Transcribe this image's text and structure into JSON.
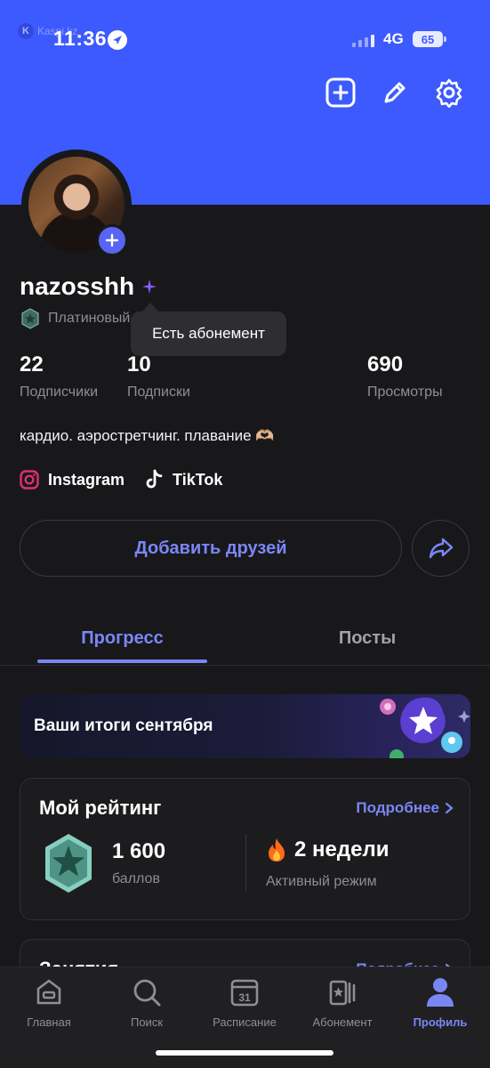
{
  "status_bar": {
    "watermark": "Kaspi.kz",
    "time": "11:36",
    "network": "4G",
    "battery": "65"
  },
  "header": {
    "actions": [
      "add-icon",
      "edit-icon",
      "settings-icon"
    ],
    "accent_color": "#3d5afe"
  },
  "profile": {
    "username": "nazosshh",
    "tier": "Платиновый",
    "tooltip": "Есть абонемент",
    "stats": [
      {
        "value": "22",
        "label": "Подписчики"
      },
      {
        "value": "10",
        "label": "Подписки"
      },
      {
        "value": "690",
        "label": "Просмотры"
      }
    ],
    "bio": "кардио. аэростретчинг. плавание 🫶🏼",
    "socials": [
      {
        "name": "Instagram",
        "icon": "instagram-icon"
      },
      {
        "name": "TikTok",
        "icon": "tiktok-icon"
      }
    ],
    "add_friends_label": "Добавить друзей"
  },
  "tabs": {
    "active": "Прогресс",
    "inactive": "Посты"
  },
  "banner": {
    "text": "Ваши итоги сентября"
  },
  "rating_card": {
    "title": "Мой рейтинг",
    "more": "Подробнее",
    "points": "1 600",
    "points_label": "баллов",
    "streak": "2 недели",
    "streak_label": "Активный режим"
  },
  "classes_card": {
    "title": "Занятия",
    "more": "Подробнее"
  },
  "tabbar": {
    "items": [
      {
        "label": "Главная",
        "icon": "home-icon"
      },
      {
        "label": "Поиск",
        "icon": "search-icon"
      },
      {
        "label": "Расписание",
        "icon": "calendar-icon",
        "badge": "31"
      },
      {
        "label": "Абонемент",
        "icon": "membership-icon"
      },
      {
        "label": "Профиль",
        "icon": "profile-icon"
      }
    ],
    "active_color": "#7b86f5"
  }
}
